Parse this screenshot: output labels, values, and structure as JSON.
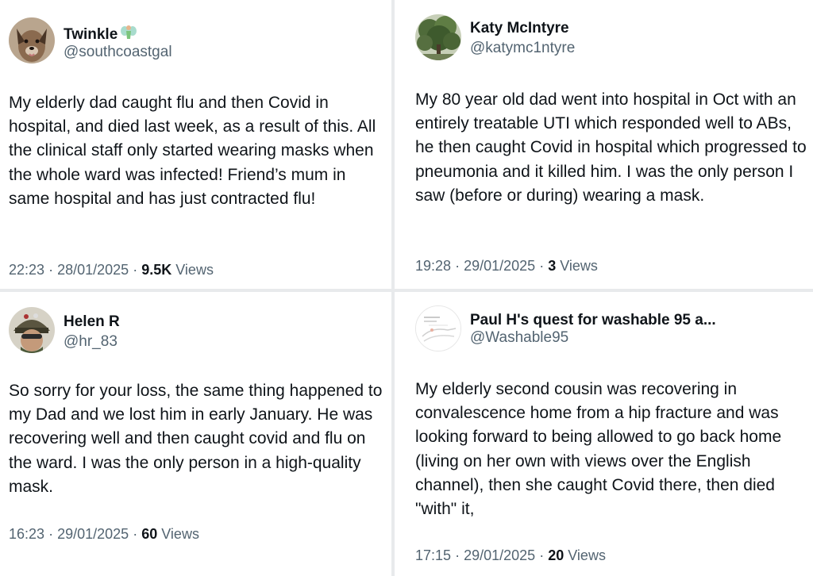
{
  "posts": [
    {
      "name": "Twinkle",
      "handle": "@southcoastgal",
      "avatar_icon": "dog-avatar",
      "body": "My elderly dad caught flu and then Covid in hospital, and died last week, as a result of this. All the clinical staff only started wearing masks when the whole ward was infected! Friend’s mum in same hospital and has just contracted flu!",
      "time": "22:23",
      "date": "28/01/2025",
      "views_count": "9.5K",
      "views_label": "Views"
    },
    {
      "name": "Katy McIntyre",
      "handle": "@katymc1ntyre",
      "avatar_icon": "tree-avatar",
      "body": "My 80 year old dad went into hospital in Oct with an entirely treatable UTI which responded well to ABs, he then caught Covid in hospital which progressed to pneumonia and it killed him. I was the only person I saw (before or during) wearing a mask.",
      "time": "19:28",
      "date": "29/01/2025",
      "views_count": "3",
      "views_label": "Views"
    },
    {
      "name": "Helen R",
      "handle": "@hr_83",
      "avatar_icon": "helmet-avatar",
      "body": "So sorry for your loss, the same thing happened to my Dad and we lost him in early January. He was recovering well and then caught covid and flu on the ward. I was the only person in a high-quality mask.",
      "time": "16:23",
      "date": "29/01/2025",
      "views_count": "60",
      "views_label": "Views"
    },
    {
      "name": "Paul H's quest for washable 95 a...",
      "handle": "@Washable95",
      "avatar_icon": "diagram-avatar",
      "body": "My elderly second cousin was recovering in convalescence home from a hip fracture and was looking forward to being allowed to go back home (living on her own with views over the English channel), then she caught Covid there, then died \"with\" it,",
      "time": "17:15",
      "date": "29/01/2025",
      "views_count": "20",
      "views_label": "Views"
    }
  ],
  "separator": "·",
  "colors": {
    "text": "#0f1419",
    "secondary": "#536471",
    "divider": "#e8eaec"
  }
}
